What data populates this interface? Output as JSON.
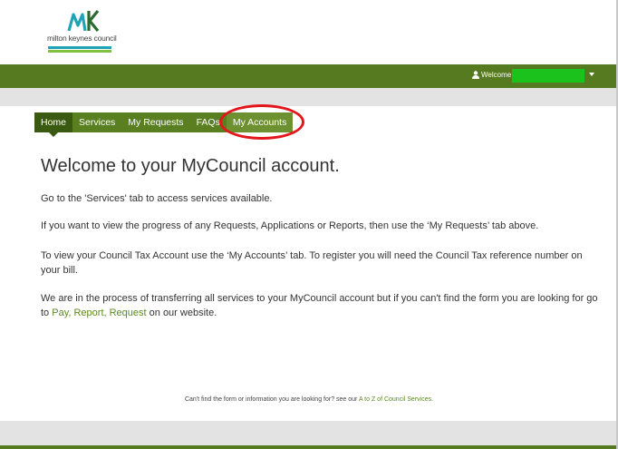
{
  "logo": {
    "text": "milton keynes council",
    "mark_color": "#1fa3b6",
    "mark_color2": "#2c6b2f"
  },
  "topbar": {
    "welcome_label": "Welcome",
    "user_icon": "user-icon",
    "bg": "#557a1f"
  },
  "nav": {
    "items": [
      {
        "label": "Home",
        "active": true
      },
      {
        "label": "Services"
      },
      {
        "label": "My Requests"
      },
      {
        "label": "FAQs"
      },
      {
        "label": "My Accounts"
      }
    ]
  },
  "main": {
    "title": "Welcome to your MyCouncil account.",
    "p1": "Go to the 'Services' tab to access services available.",
    "p2": "If you want to view the progress of any Requests, Applications or Reports, then use the ‘My Requests’ tab above.",
    "p3": "To view your Council Tax Account use the ‘My Accounts’ tab. To register you will need the Council Tax reference number on your bill.",
    "p4_before": "We are in the process of transferring all services to your MyCouncil account but if you can't find the form you are looking for go to ",
    "p4_link": "Pay, Report, Request",
    "p4_after": " on our website."
  },
  "footer": {
    "text_before": "Can't find the form or information you are looking for? see our ",
    "link": "A to Z of Council Services."
  }
}
